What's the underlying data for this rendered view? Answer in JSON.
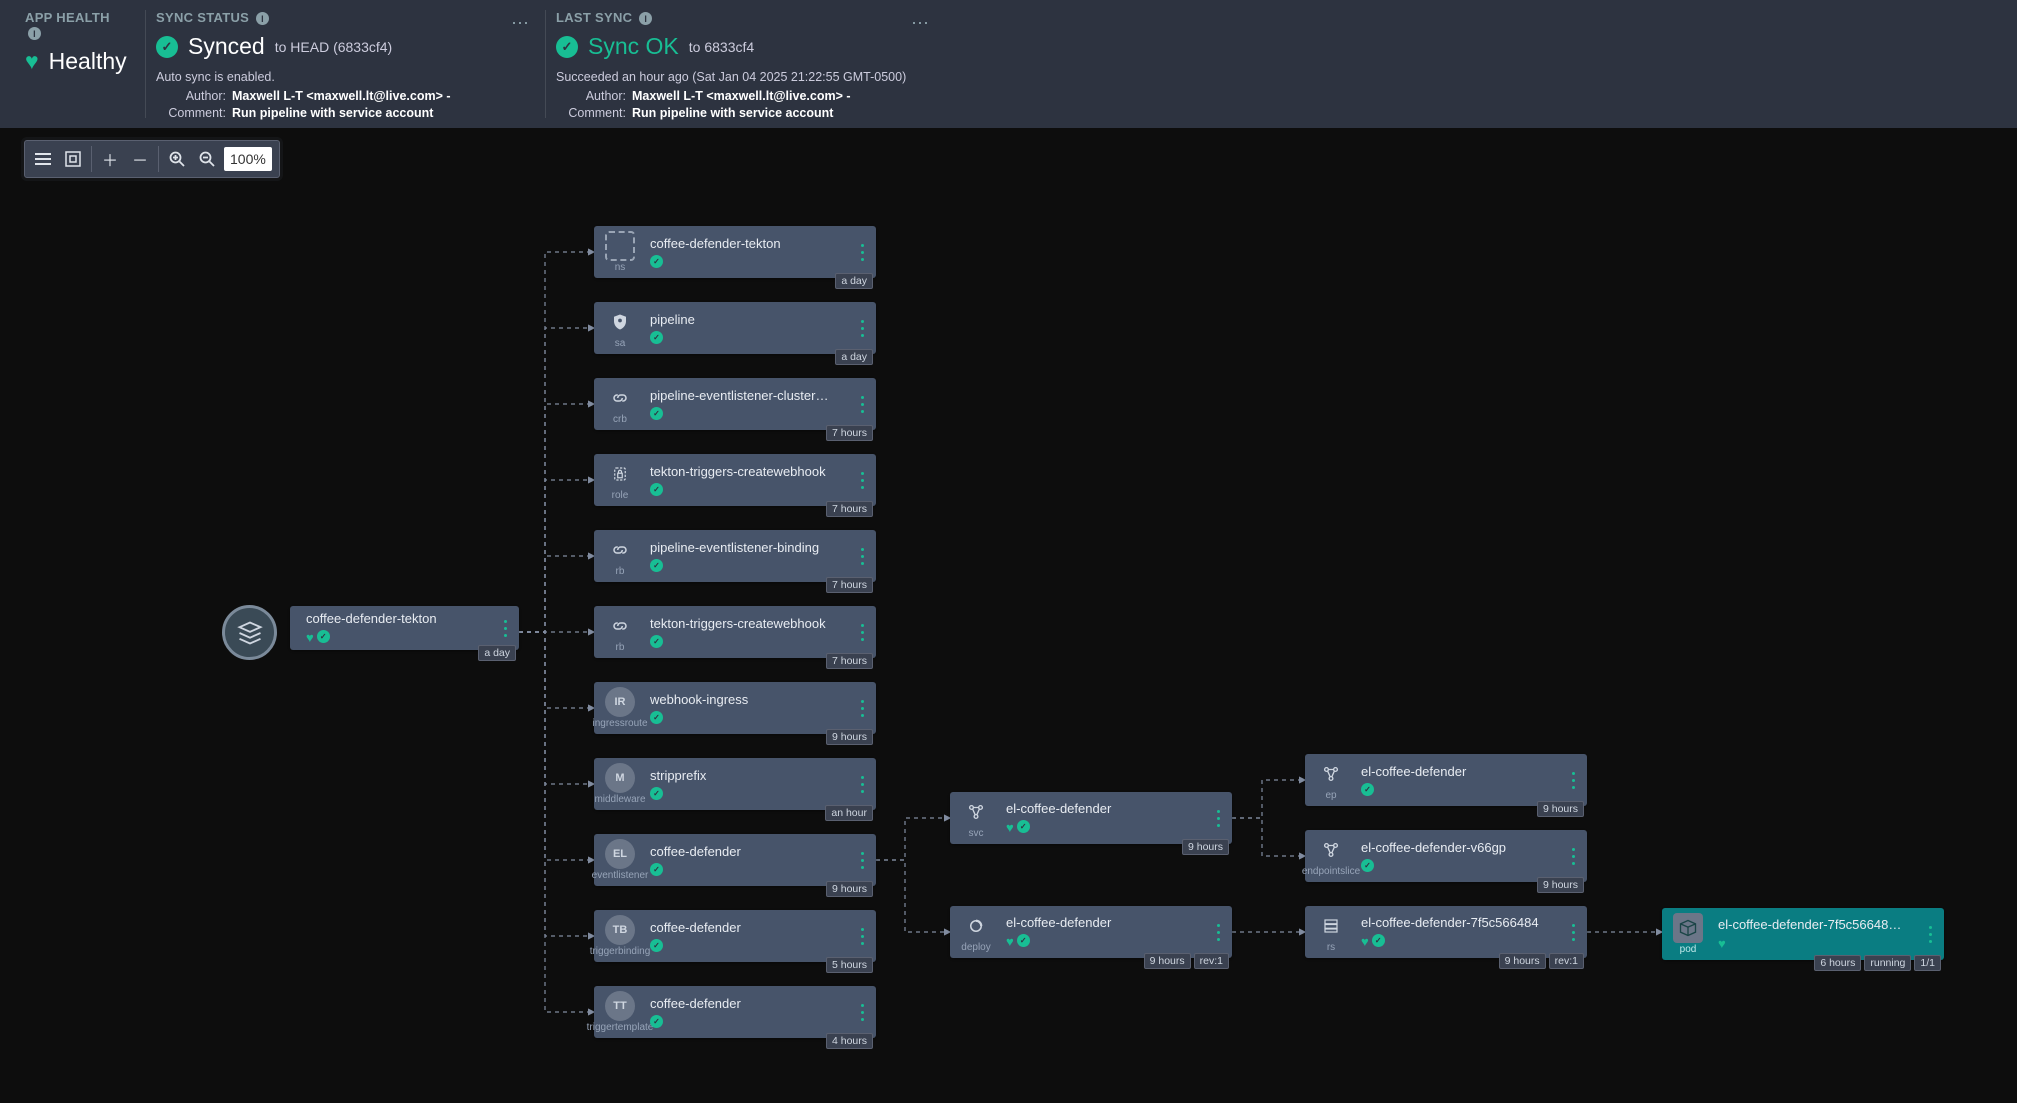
{
  "header": {
    "appHealth": {
      "title": "APP HEALTH",
      "statusText": "Healthy"
    },
    "syncStatus": {
      "title": "SYNC STATUS",
      "statusText": "Synced",
      "extra": "to HEAD (6833cf4)",
      "subline": "Auto sync is enabled.",
      "authorLabel": "Author:",
      "author": "Maxwell L-T <maxwell.lt@live.com> -",
      "commentLabel": "Comment:",
      "comment": "Run pipeline with service account"
    },
    "lastSync": {
      "title": "LAST SYNC",
      "statusText": "Sync OK",
      "extra": "to 6833cf4",
      "subline": "Succeeded an hour ago (Sat Jan 04 2025 21:22:55 GMT-0500)",
      "authorLabel": "Author:",
      "author": "Maxwell L-T <maxwell.lt@live.com> -",
      "commentLabel": "Comment:",
      "comment": "Run pipeline with service account"
    }
  },
  "toolbar": {
    "zoom": "100%"
  },
  "root": {
    "title": "coffee-defender-tekton",
    "age": "a day"
  },
  "col2": [
    {
      "kind": "ns",
      "title": "coffee-defender-tekton",
      "age": "a day"
    },
    {
      "kind": "sa",
      "title": "pipeline",
      "age": "a day"
    },
    {
      "kind": "crb",
      "title": "pipeline-eventlistener-cluster…",
      "age": "7 hours"
    },
    {
      "kind": "role",
      "title": "tekton-triggers-createwebhook",
      "age": "7 hours"
    },
    {
      "kind": "rb",
      "title": "pipeline-eventlistener-binding",
      "age": "7 hours"
    },
    {
      "kind": "rb",
      "title": "tekton-triggers-createwebhook",
      "age": "7 hours"
    },
    {
      "kind": "ingressroute",
      "title": "webhook-ingress",
      "age": "9 hours",
      "iconText": "IR"
    },
    {
      "kind": "middleware",
      "title": "stripprefix",
      "age": "an hour",
      "iconText": "M"
    },
    {
      "kind": "eventlistener",
      "title": "coffee-defender",
      "age": "9 hours",
      "iconText": "EL"
    },
    {
      "kind": "triggerbinding",
      "title": "coffee-defender",
      "age": "5 hours",
      "iconText": "TB"
    },
    {
      "kind": "triggertemplate",
      "title": "coffee-defender",
      "age": "4 hours",
      "iconText": "TT"
    }
  ],
  "col3": [
    {
      "kind": "svc",
      "title": "el-coffee-defender",
      "age": "9 hours"
    },
    {
      "kind": "deploy",
      "title": "el-coffee-defender",
      "age": "9 hours",
      "rev": "rev:1"
    }
  ],
  "col4": [
    {
      "kind": "ep",
      "title": "el-coffee-defender",
      "age": "9 hours"
    },
    {
      "kind": "endpointslice",
      "title": "el-coffee-defender-v66gp",
      "age": "9 hours"
    },
    {
      "kind": "rs",
      "title": "el-coffee-defender-7f5c566484",
      "age": "9 hours",
      "rev": "rev:1"
    }
  ],
  "col5": {
    "kind": "pod",
    "title": "el-coffee-defender-7f5c56648…",
    "age": "6 hours",
    "status": "running",
    "ready": "1/1"
  }
}
